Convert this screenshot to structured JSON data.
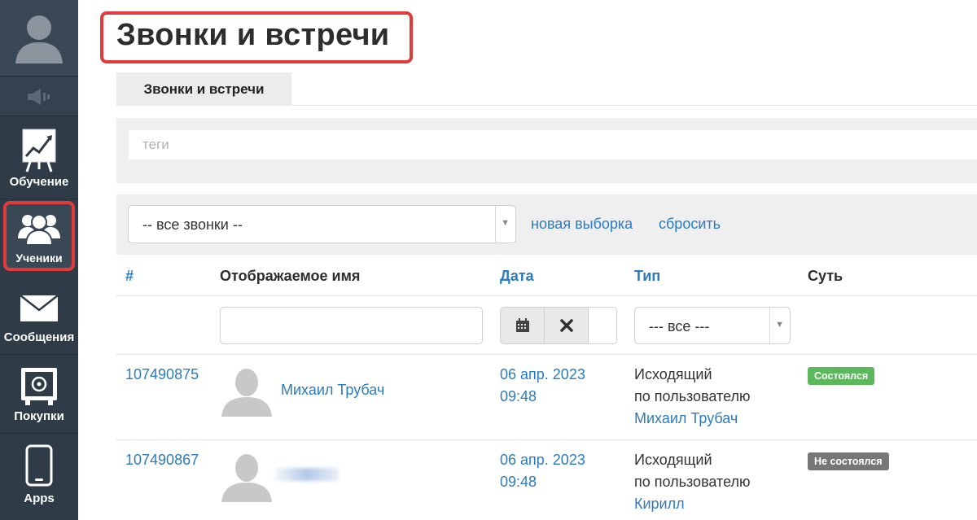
{
  "sidebar": {
    "items": [
      {
        "label": "Обучение",
        "icon": "chart-board-icon"
      },
      {
        "label": "Ученики",
        "icon": "users-icon",
        "active": true
      },
      {
        "label": "Сообщения",
        "icon": "envelope-icon"
      },
      {
        "label": "Покупки",
        "icon": "safe-icon"
      },
      {
        "label": "Apps",
        "icon": "phone-icon"
      }
    ]
  },
  "page": {
    "title": "Звонки и встречи",
    "tab_label": "Звонки и встречи"
  },
  "tags": {
    "placeholder": "теги"
  },
  "filter": {
    "select_value": "-- все звонки --",
    "new_selection_link": "новая выборка",
    "reset_link": "сбросить"
  },
  "table": {
    "headers": {
      "id": "#",
      "name": "Отображаемое имя",
      "date": "Дата",
      "type": "Тип",
      "essence": "Суть"
    },
    "type_filter_value": "--- все ---",
    "rows": [
      {
        "id": "107490875",
        "name": "Михаил Трубач",
        "date": "06 апр. 2023",
        "time": "09:48",
        "type_line1": "Исходящий",
        "type_line2": "по пользователю",
        "type_user": "Михаил Трубач",
        "status": "Состоялся"
      },
      {
        "id": "107490867",
        "name": "",
        "date": "06 апр. 2023",
        "time": "09:48",
        "type_line1": "Исходящий",
        "type_line2": "по пользователю",
        "type_user": "Кирилл",
        "status": "Не состоялся"
      }
    ]
  },
  "colors": {
    "sidebar_bg": "#2f3b47",
    "link_blue": "#2d7bbf",
    "highlight_red": "#e03a3a",
    "status_ok": "#5cb85c",
    "status_fail": "#777777"
  }
}
